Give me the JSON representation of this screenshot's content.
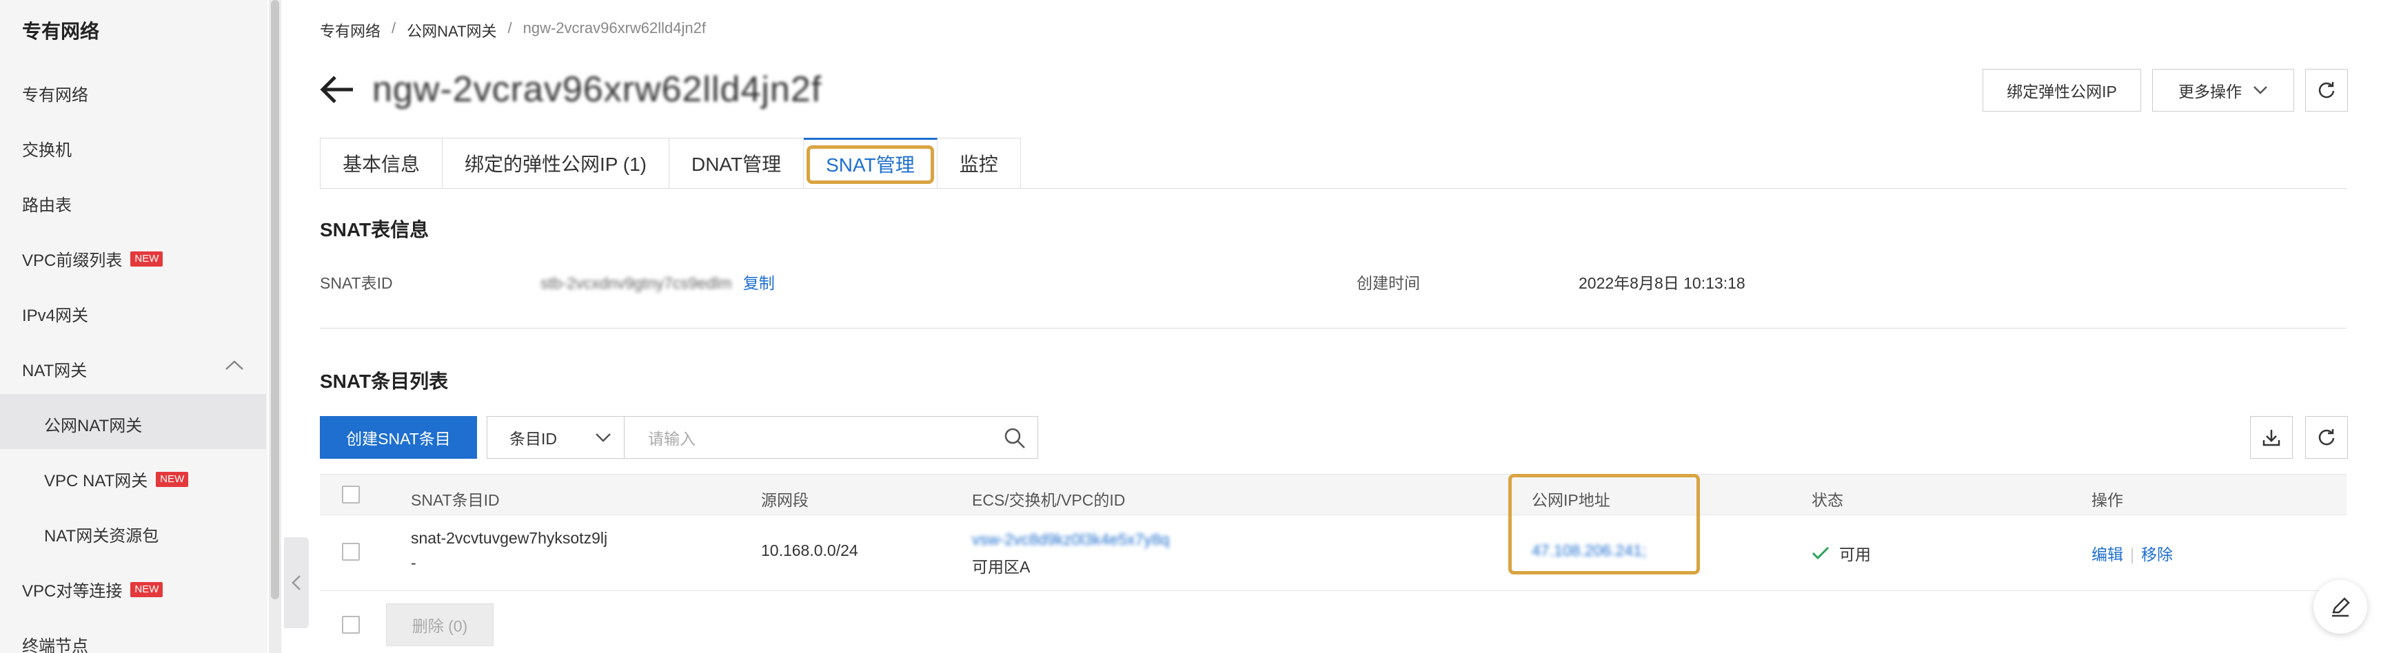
{
  "sidebar": {
    "title": "专有网络",
    "items": [
      {
        "label": "专有网络"
      },
      {
        "label": "交换机"
      },
      {
        "label": "路由表"
      },
      {
        "label": "VPC前缀列表",
        "badge": "NEW"
      },
      {
        "label": "IPv4网关"
      },
      {
        "label": "NAT网关"
      },
      {
        "label": "公网NAT网关"
      },
      {
        "label": "VPC NAT网关",
        "badge": "NEW"
      },
      {
        "label": "NAT网关资源包"
      },
      {
        "label": "VPC对等连接",
        "badge": "NEW"
      },
      {
        "label": "终端节点"
      }
    ]
  },
  "breadcrumb": {
    "items": [
      "专有网络",
      "公网NAT网关",
      "ngw-2vcrav96xrw62lld4jn2f"
    ],
    "separator": "/"
  },
  "header": {
    "title": "ngw-2vcrav96xrw62lld4jn2f",
    "bind_eip_label": "绑定弹性公网IP",
    "more_actions_label": "更多操作"
  },
  "tabs": [
    {
      "label": "基本信息"
    },
    {
      "label": "绑定的弹性公网IP (1)"
    },
    {
      "label": "DNAT管理"
    },
    {
      "label": "SNAT管理",
      "active": true
    },
    {
      "label": "监控"
    }
  ],
  "snat_info": {
    "section_title": "SNAT表信息",
    "id_label": "SNAT表ID",
    "id_value": "stb-2vcxdnv9gtny7cs9edlm",
    "copy_label": "复制",
    "created_label": "创建时间",
    "created_value": "2022年8月8日 10:13:18"
  },
  "snat_list": {
    "section_title": "SNAT条目列表",
    "create_button": "创建SNAT条目",
    "filter_select": "条目ID",
    "search_placeholder": "请输入",
    "columns": [
      "SNAT条目ID",
      "源网段",
      "ECS/交换机/VPC的ID",
      "公网IP地址",
      "状态",
      "操作"
    ],
    "rows": [
      {
        "id_line1": "snat-2vcvtuvgew7hyksotz9lj",
        "id_line2": "-",
        "source_cidr": "10.168.0.0/24",
        "vsw_id": "vsw-2vc8d9kz0l3k4e5x7y8q",
        "zone": "可用区A",
        "public_ip": "47.108.206.241;",
        "status": "可用",
        "op_edit": "编辑",
        "op_remove": "移除"
      }
    ],
    "delete_button": "删除 (0)"
  },
  "colors": {
    "accent": "#1e6fcf",
    "highlight": "#d9a441",
    "new_badge": "#e4393c",
    "ok_green": "#2aa45a"
  }
}
